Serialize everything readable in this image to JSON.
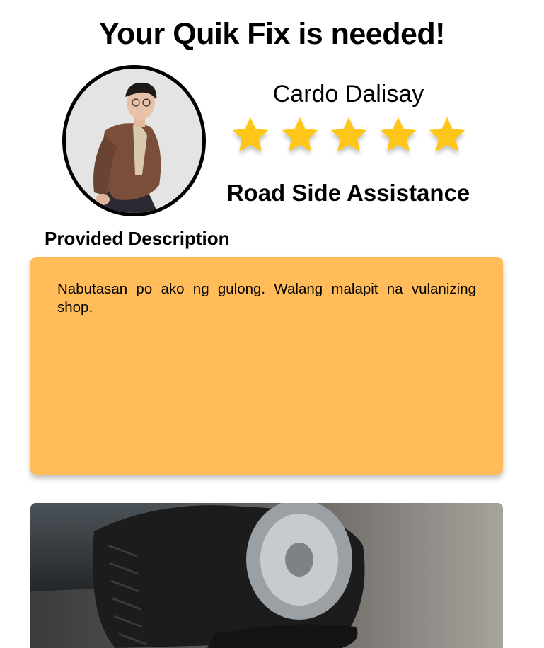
{
  "header": {
    "title": "Your Quik Fix is needed!"
  },
  "profile": {
    "name": "Cardo Dalisay",
    "rating": {
      "value": 5,
      "max": 5,
      "star_color": "#ffc61a"
    },
    "service_type": "Road Side Assistance",
    "avatar_icon": "user-photo"
  },
  "description": {
    "label": "Provided Description",
    "text": "Nabutasan po ako ng gulong. Walang malapit na vulanizing shop.",
    "card_color": "#ffbc59"
  },
  "attachment": {
    "icon": "flat-tire-photo"
  }
}
